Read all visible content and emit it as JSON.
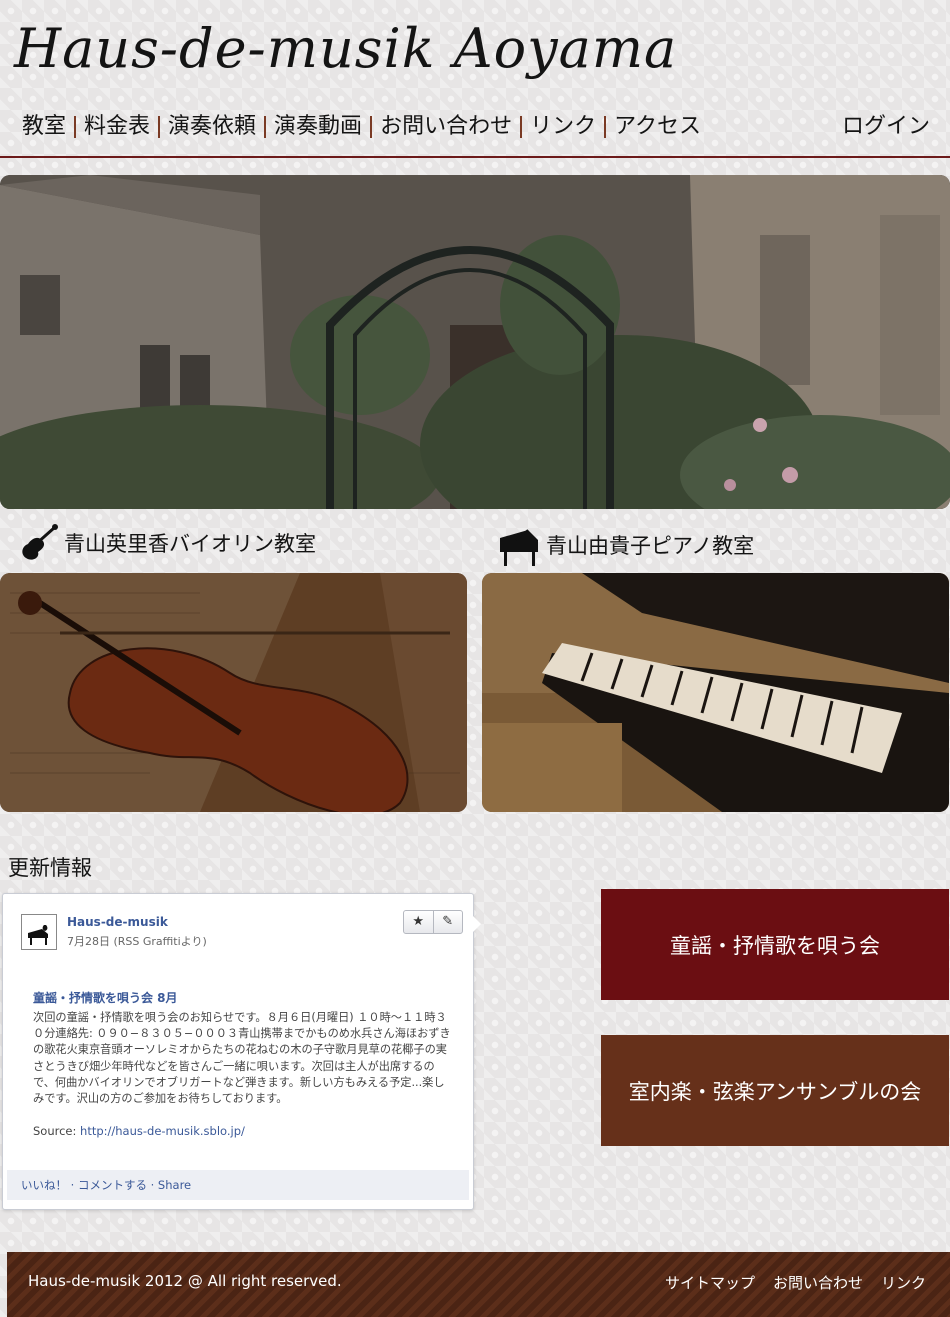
{
  "site": {
    "logo": "Haus-de-musik Aoyama"
  },
  "nav": {
    "items": [
      "教室",
      "料金表",
      "演奏依頼",
      "演奏動画",
      "お問い合わせ",
      "リンク",
      "アクセス"
    ],
    "login": "ログイン"
  },
  "classes": {
    "violin": {
      "title": "青山英里香バイオリン教室",
      "icon": "violin-icon"
    },
    "piano": {
      "title": "青山由貴子ピアノ教室",
      "icon": "piano-icon"
    }
  },
  "news": {
    "heading": "更新情報",
    "post": {
      "author": "Haus-de-musik",
      "date": "7月28日 (RSS Graffitiより)",
      "tool_star": "★",
      "tool_edit": "✎",
      "title": "童謡・抒情歌を唄う会 8月",
      "body": "次回の童謡・抒情歌を唄う会のお知らせです。８月６日(月曜日) １０時〜１１時３０分連絡先: ０９０−８３０５−０００３青山携帯までかものめ水兵さん海ほおずきの歌花火東京音頭オーソレミオからたちの花ねむの木の子守歌月見草の花椰子の実さとうきび畑少年時代などを皆さんご一緒に唄います。次回は主人が出席するので、何曲かバイオリンでオブリガートなど弾きます。新しい方もみえる予定...楽しみです。沢山の方のご参加をお待ちしております。",
      "source_label": "Source: ",
      "source_url": "http://haus-de-musik.sblo.jp/",
      "actions": "いいね！ · コメントする · Share"
    }
  },
  "promos": {
    "singing": "童謡・抒情歌を唄う会",
    "ensemble": "室内楽・弦楽アンサンブルの会"
  },
  "footer": {
    "copyright": "Haus-de-musik 2012 @ All right reserved.",
    "links": [
      "サイトマップ",
      "お問い合わせ",
      "リンク"
    ]
  },
  "colors": {
    "accent_red": "#6b0e12",
    "accent_brown": "#66301a",
    "nav_rule": "#6c1a1a"
  }
}
